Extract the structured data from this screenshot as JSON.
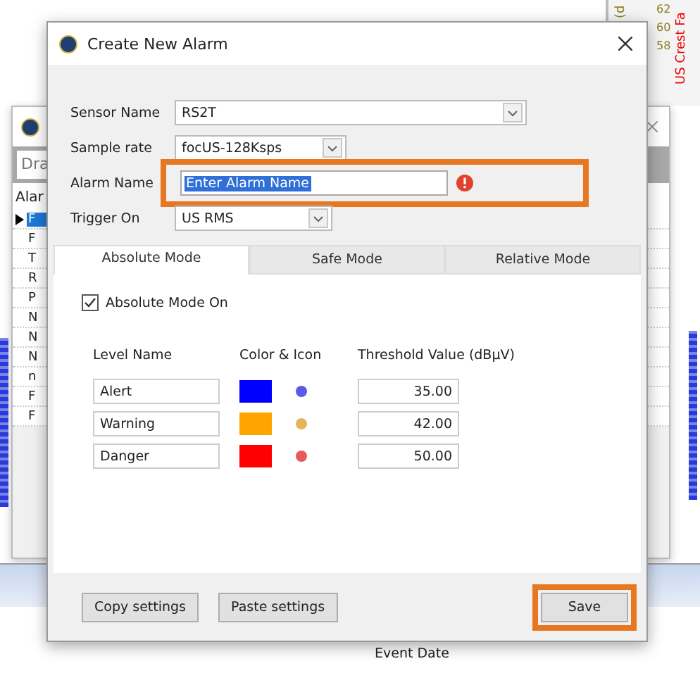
{
  "background": {
    "axis_label": "(d",
    "chart_title": "US Crest Fa",
    "ticks": [
      "62",
      "60",
      "58"
    ],
    "window": {
      "filter_value": "Dra",
      "list_header": "Alar",
      "rows": [
        "F",
        "F",
        "T",
        "R",
        "P",
        "N",
        "N",
        "N",
        "n",
        "F",
        "F"
      ]
    },
    "column_header": "Event Date"
  },
  "dialog": {
    "title": "Create New Alarm",
    "fields": [
      {
        "label": "Sensor Name",
        "kind": "combo",
        "value": "RS2T",
        "highlighted": false,
        "error": false
      },
      {
        "label": "Sample rate",
        "kind": "combo",
        "value": "focUS-128Ksps",
        "highlighted": false,
        "error": false
      },
      {
        "label": "Alarm Name",
        "kind": "text",
        "value": "Enter Alarm Name",
        "highlighted": true,
        "error": true
      },
      {
        "label": "Trigger On",
        "kind": "combo",
        "value": "US RMS",
        "highlighted": false,
        "error": false
      }
    ],
    "tabs": [
      {
        "label": "Absolute Mode",
        "selected": true
      },
      {
        "label": "Safe Mode",
        "selected": false
      },
      {
        "label": "Relative Mode",
        "selected": false
      }
    ],
    "mode_checkbox": {
      "label": "Absolute Mode On",
      "checked": true
    },
    "columns": [
      "Level Name",
      "Color & Icon",
      "Threshold Value (dBμV)"
    ],
    "levels": [
      {
        "name": "Alert",
        "color": "#0000ff",
        "threshold": "35.00"
      },
      {
        "name": "Warning",
        "color": "#ffa500",
        "threshold": "42.00"
      },
      {
        "name": "Danger",
        "color": "#ff0000",
        "threshold": "50.00"
      }
    ],
    "buttons": [
      {
        "label": "Copy settings",
        "highlighted": false
      },
      {
        "label": "Paste settings",
        "highlighted": false
      },
      {
        "label": "Save",
        "highlighted": true
      }
    ]
  }
}
